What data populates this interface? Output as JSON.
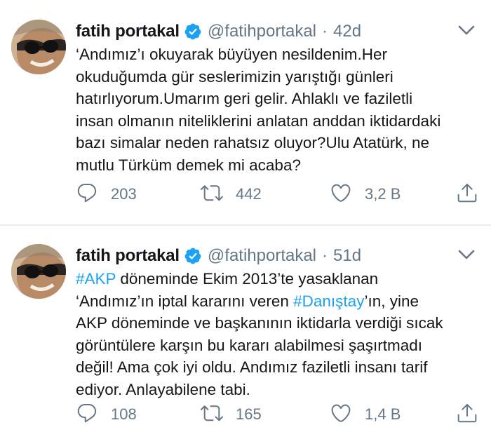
{
  "colors": {
    "accent": "#1da1f2",
    "secondary_text": "#657786",
    "primary_text": "#14171a",
    "divider": "#e6ecf0"
  },
  "tweets": [
    {
      "author": {
        "display_name": "fatih portakal",
        "handle": "@fatihportakal",
        "verified_icon": "verified-badge-icon"
      },
      "separator": "·",
      "age": "42d",
      "text_lines": [
        [
          {
            "text": "‘Andımız’ı okuyarak büyüyen nesildenim.Her"
          }
        ],
        [
          {
            "text": "okuduğumda gür seslerimizin yarıştığı günleri"
          }
        ],
        [
          {
            "text": "hatırlıyorum.Umarım geri gelir. Ahlaklı ve faziletli"
          }
        ],
        [
          {
            "text": "insan olmanın niteliklerini anlatan anddan iktidardaki"
          }
        ],
        [
          {
            "text": "bazı simalar neden rahatsız oluyor?Ulu Atatürk, ne"
          }
        ],
        [
          {
            "text": "mutlu Türküm demek mi acaba?"
          }
        ]
      ],
      "actions": {
        "reply_count": "203",
        "retweet_count": "442",
        "like_count": "3,2 B"
      }
    },
    {
      "author": {
        "display_name": "fatih portakal",
        "handle": "@fatihportakal",
        "verified_icon": "verified-badge-icon"
      },
      "separator": "·",
      "age": "51d",
      "text_lines": [
        [
          {
            "text": "#AKP",
            "hashtag": true
          },
          {
            "text": " döneminde Ekim 2013’te yasaklanan"
          }
        ],
        [
          {
            "text": "‘Andımız’ın iptal kararını veren "
          },
          {
            "text": "#Danıştay",
            "hashtag": true
          },
          {
            "text": "’ın, yine"
          }
        ],
        [
          {
            "text": "AKP döneminde ve başkanının iktidarla verdiği sıcak"
          }
        ],
        [
          {
            "text": "görüntülere karşın bu kararı alabilmesi şaşırtmadı"
          }
        ],
        [
          {
            "text": "değil! Ama çok iyi oldu. Andımız faziletli insanı tarif"
          }
        ],
        [
          {
            "text": "ediyor. Anlayabilene tabi."
          }
        ]
      ],
      "actions": {
        "reply_count": "108",
        "retweet_count": "165",
        "like_count": "1,4 B"
      }
    }
  ]
}
